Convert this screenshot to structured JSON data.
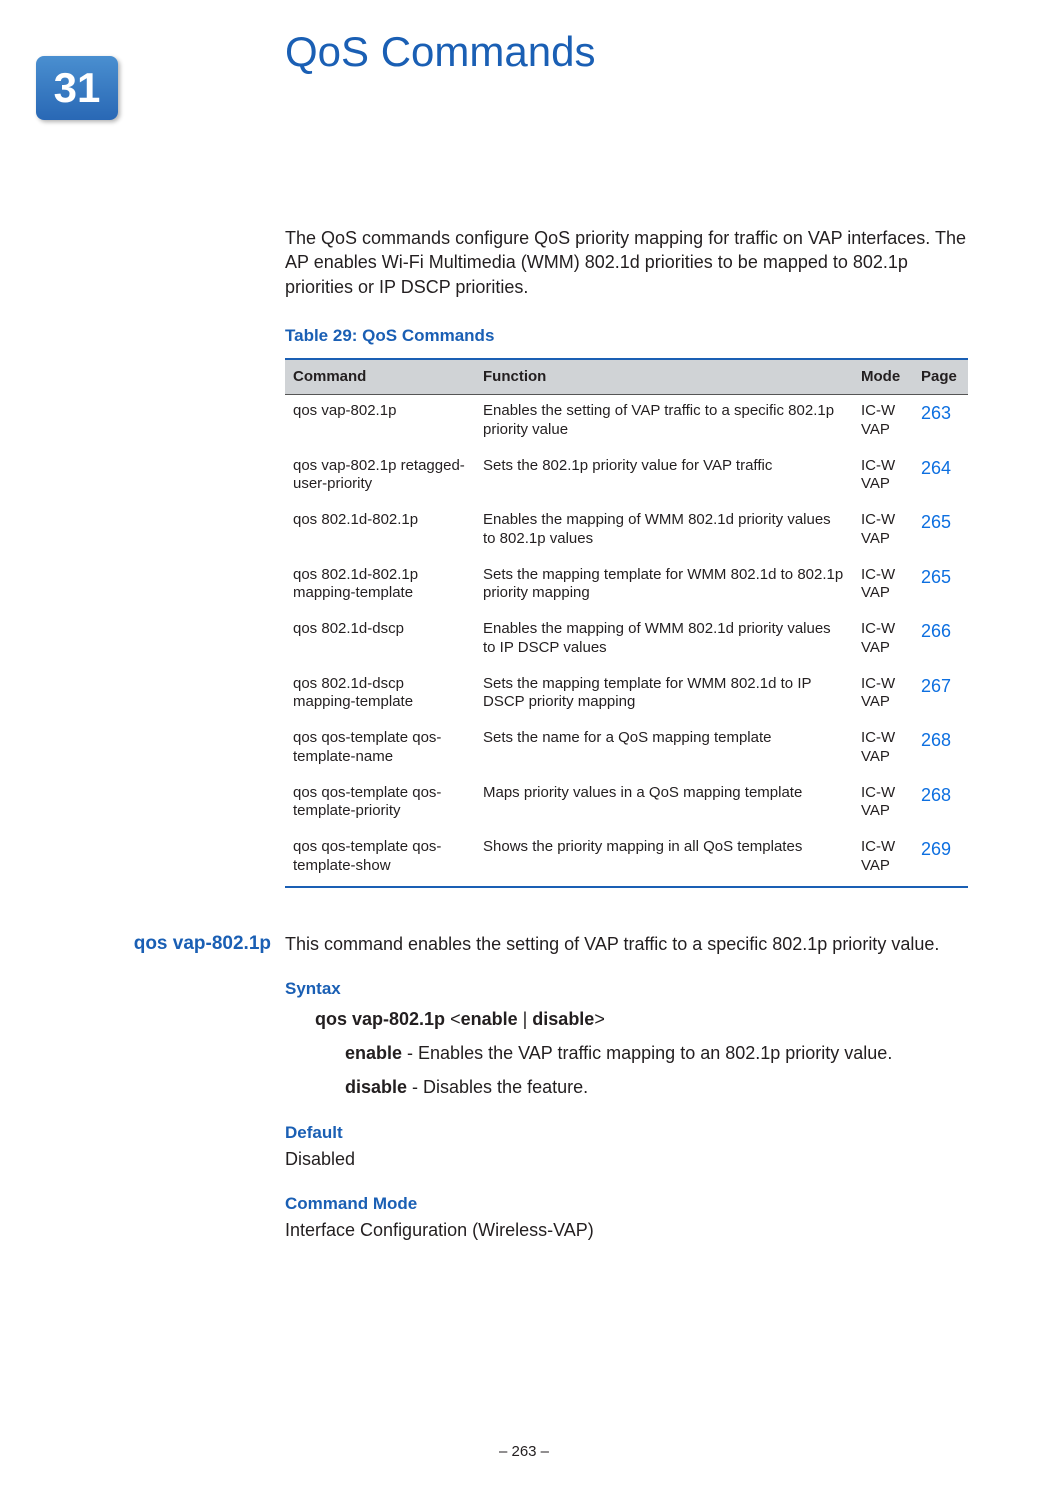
{
  "chapter": {
    "number": "31",
    "title": "QoS Commands"
  },
  "intro": "The QoS commands configure QoS priority mapping for traffic on VAP interfaces. The AP enables Wi-Fi Multimedia (WMM) 802.1d priorities to be mapped to 802.1p priorities or IP DSCP priorities.",
  "table": {
    "title": "Table 29: QoS Commands",
    "headers": {
      "command": "Command",
      "function": "Function",
      "mode": "Mode",
      "page": "Page"
    },
    "rows": [
      {
        "cmd": "qos vap-802.1p",
        "func": "Enables the setting of VAP traffic to a specific 802.1p priority value",
        "mode": "IC-W VAP",
        "page": "263"
      },
      {
        "cmd": "qos vap-802.1p retagged-user-priority",
        "func": "Sets the 802.1p priority value for VAP traffic",
        "mode": "IC-W VAP",
        "page": "264"
      },
      {
        "cmd": "qos 802.1d-802.1p",
        "func": "Enables the mapping of WMM 802.1d priority values to 802.1p values",
        "mode": "IC-W VAP",
        "page": "265"
      },
      {
        "cmd": "qos 802.1d-802.1p mapping-template",
        "func": "Sets the mapping template for WMM 802.1d  to 802.1p priority mapping",
        "mode": "IC-W VAP",
        "page": "265"
      },
      {
        "cmd": "qos 802.1d-dscp",
        "func": "Enables the mapping of WMM 802.1d priority values to IP DSCP values",
        "mode": "IC-W VAP",
        "page": "266"
      },
      {
        "cmd": "qos 802.1d-dscp mapping-template",
        "func": "Sets the mapping template for WMM 802.1d  to IP DSCP priority mapping",
        "mode": "IC-W VAP",
        "page": "267"
      },
      {
        "cmd": "qos qos-template qos-template-name",
        "func": "Sets the name for a QoS mapping template",
        "mode": "IC-W VAP",
        "page": "268"
      },
      {
        "cmd": "qos qos-template qos-template-priority",
        "func": "Maps priority values in a QoS mapping template",
        "mode": "IC-W VAP",
        "page": "268"
      },
      {
        "cmd": "qos qos-template qos-template-show",
        "func": "Shows the priority mapping in all QoS templates",
        "mode": "IC-W VAP",
        "page": "269"
      }
    ]
  },
  "section": {
    "heading": "qos vap-802.1p",
    "desc": "This command enables the setting of VAP traffic to a specific 802.1p priority value.",
    "syntax": {
      "label": "Syntax",
      "line_bold1": "qos vap-802.1p",
      "lt": " <",
      "opt1": "enable",
      "sep": " | ",
      "opt2": "disable",
      "gt": ">",
      "p1_b": "enable",
      "p1_t": " - Enables the VAP traffic mapping to an 802.1p priority value.",
      "p2_b": "disable",
      "p2_t": " - Disables the feature."
    },
    "default": {
      "label": "Default",
      "value": "Disabled"
    },
    "mode": {
      "label": "Command Mode",
      "value": "Interface Configuration (Wireless-VAP)"
    }
  },
  "footer": "–  263  –"
}
